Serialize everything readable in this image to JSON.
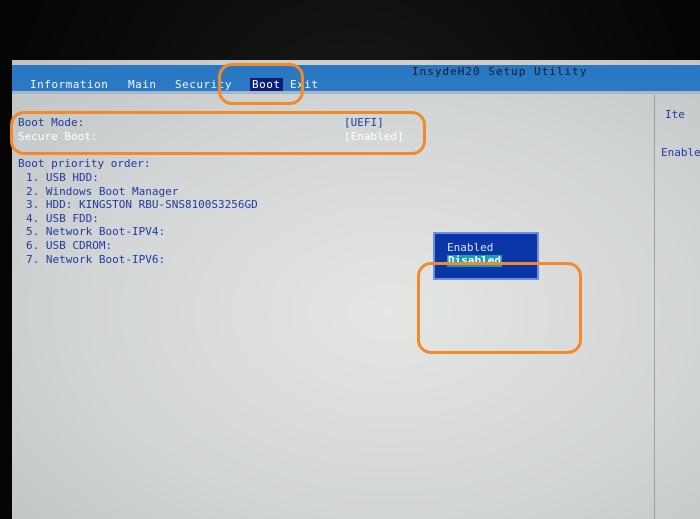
{
  "window": {
    "utility_title": "InsydeH20 Setup Utility"
  },
  "menu": {
    "items": [
      {
        "label": "Information"
      },
      {
        "label": "Main"
      },
      {
        "label": "Security"
      },
      {
        "label": "Boot",
        "active": true
      },
      {
        "label": "Exit"
      }
    ]
  },
  "settings": {
    "boot_mode": {
      "label": "Boot Mode:",
      "value": "[UEFI]"
    },
    "secure_boot": {
      "label": "Secure Boot:",
      "value": "[Enabled]"
    }
  },
  "boot_priority": {
    "heading": "Boot priority order:",
    "items": [
      "1.  USB HDD:",
      "2.  Windows Boot Manager",
      "3.  HDD: KINGSTON RBU-SNS8100S3256GD",
      "4.  USB FDD:",
      "5.  Network Boot-IPV4:",
      "6.  USB CDROM:",
      "7.  Network Boot-IPV6:"
    ]
  },
  "help_panel": {
    "title": "Ite",
    "text": "Enable"
  },
  "popup": {
    "options": [
      "Enabled",
      "Disabled"
    ],
    "selected": "Disabled"
  },
  "colors": {
    "menubar": "#2b79c4",
    "text_blue": "#1f3aa3",
    "popup_bg": "#0a36a8",
    "popup_selected": "#1b9fb9",
    "annotation_orange": "#f28a2a"
  }
}
